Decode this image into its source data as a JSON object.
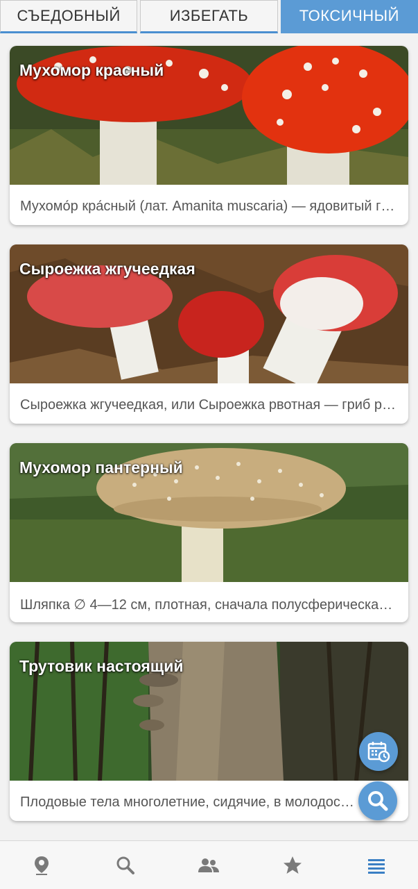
{
  "tabs": [
    {
      "label": "СЪЕДОБНЫЙ",
      "active": false
    },
    {
      "label": "ИЗБЕГАТЬ",
      "active": false
    },
    {
      "label": "ТОКСИЧНЫЙ",
      "active": true
    }
  ],
  "cards": [
    {
      "title": "Мухомор красный",
      "desc": "Мухомо́р кра́сный (лат. Amanita muscaria) — ядовитый гриб рода Мухомор",
      "image": "red-fly-agaric"
    },
    {
      "title": "Сыроежка жгучеедкая",
      "desc": "Сыроежка жгучеедкая, или Сыроежка рвотная — гриб рода Сыроежка",
      "image": "russula-emetica"
    },
    {
      "title": "Мухомор пантерный",
      "desc": "Шляпка ∅ 4—12 см, плотная, сначала полусферическая, затем выпуклая",
      "image": "panther-cap"
    },
    {
      "title": "Трутовик настоящий",
      "desc": "Плодовые тела многолетние, сидячие, в молодости округлые",
      "image": "tinder-fungus"
    }
  ],
  "fabs": {
    "calendar": "calendar-clock-icon",
    "search": "search-icon"
  },
  "bottom_nav": [
    {
      "icon": "map-pin-icon",
      "active": false
    },
    {
      "icon": "search-icon",
      "active": false
    },
    {
      "icon": "people-icon",
      "active": false
    },
    {
      "icon": "star-icon",
      "active": false
    },
    {
      "icon": "menu-icon",
      "active": true
    }
  ],
  "colors": {
    "accent": "#5b9bd5",
    "inactive_icon": "#7a7a7a"
  }
}
